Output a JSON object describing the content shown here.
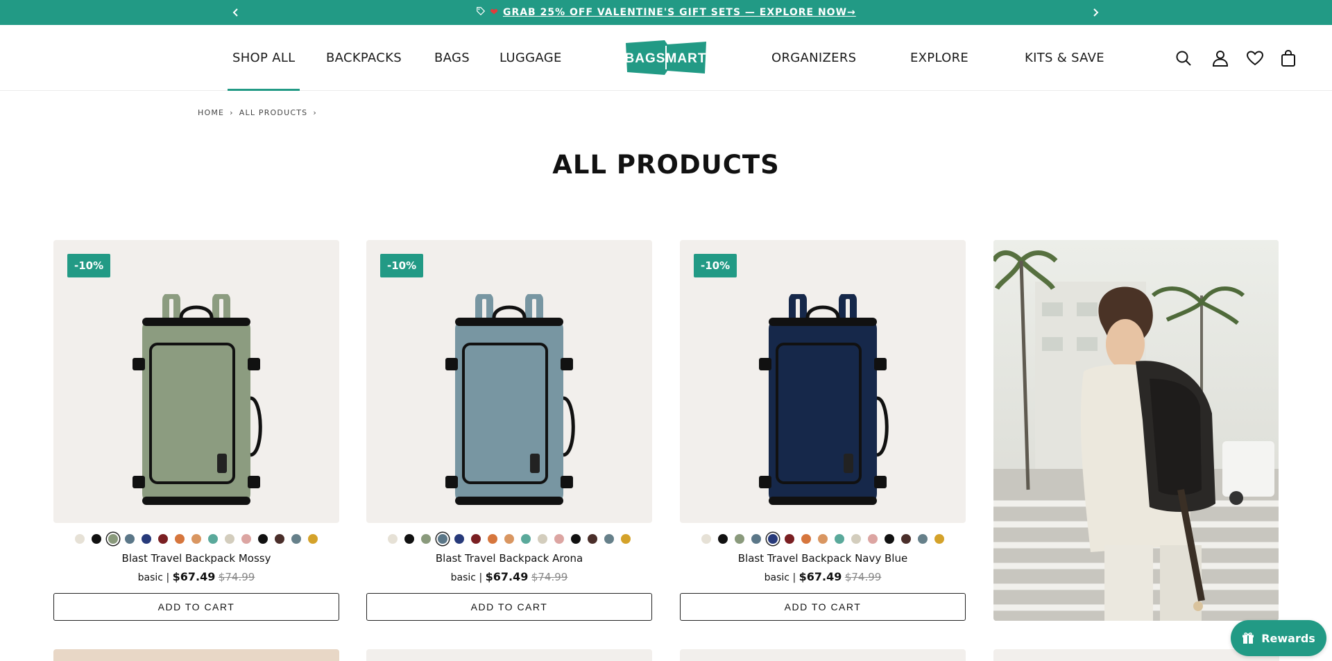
{
  "announcement": {
    "text": "GRAB 25% OFF VALENTINE'S GIFT SETS — EXPLORE NOW→",
    "prev_icon": "chevron-left-icon",
    "next_icon": "chevron-right-icon"
  },
  "header": {
    "logo_text": "BAGSMART",
    "nav_left": [
      {
        "label": "SHOP ALL",
        "active": true
      },
      {
        "label": "BACKPACKS"
      },
      {
        "label": "BAGS"
      },
      {
        "label": "LUGGAGE"
      }
    ],
    "nav_right": [
      {
        "label": "ORGANIZERS"
      },
      {
        "label": "EXPLORE"
      },
      {
        "label": "KITS & SAVE"
      }
    ],
    "icons": [
      "search-icon",
      "account-icon",
      "wishlist-icon",
      "cart-icon"
    ]
  },
  "breadcrumb": [
    "HOME",
    "ALL PRODUCTS"
  ],
  "page_title": "ALL PRODUCTS",
  "colors": {
    "accent": "#229a85",
    "card_bg": "#f2efec",
    "swatches": [
      "#e6e1d6",
      "#111111",
      "#8a9a7c",
      "#5b7788",
      "#273a7a",
      "#7a1f22",
      "#d6763d",
      "#d99661",
      "#5aa99b",
      "#d3cdbd",
      "#dca5a2",
      "#111111",
      "#4a2e2a",
      "#66808a",
      "#d4a22a"
    ]
  },
  "products": [
    {
      "badge": "-10%",
      "name": "Blast Travel Backpack Mossy",
      "variant": "basic",
      "price": "$67.49",
      "was": "$74.99",
      "cta": "ADD TO CART",
      "selected_swatch": 2,
      "bag_color": "#8c9c80"
    },
    {
      "badge": "-10%",
      "name": "Blast Travel Backpack Arona",
      "variant": "basic",
      "price": "$67.49",
      "was": "$74.99",
      "cta": "ADD TO CART",
      "selected_swatch": 3,
      "bag_color": "#7896a2"
    },
    {
      "badge": "-10%",
      "name": "Blast Travel Backpack Navy Blue",
      "variant": "basic",
      "price": "$67.49",
      "was": "$74.99",
      "cta": "ADD TO CART",
      "selected_swatch": 4,
      "bag_color": "#16284a"
    }
  ],
  "rewards_label": "Rewards"
}
